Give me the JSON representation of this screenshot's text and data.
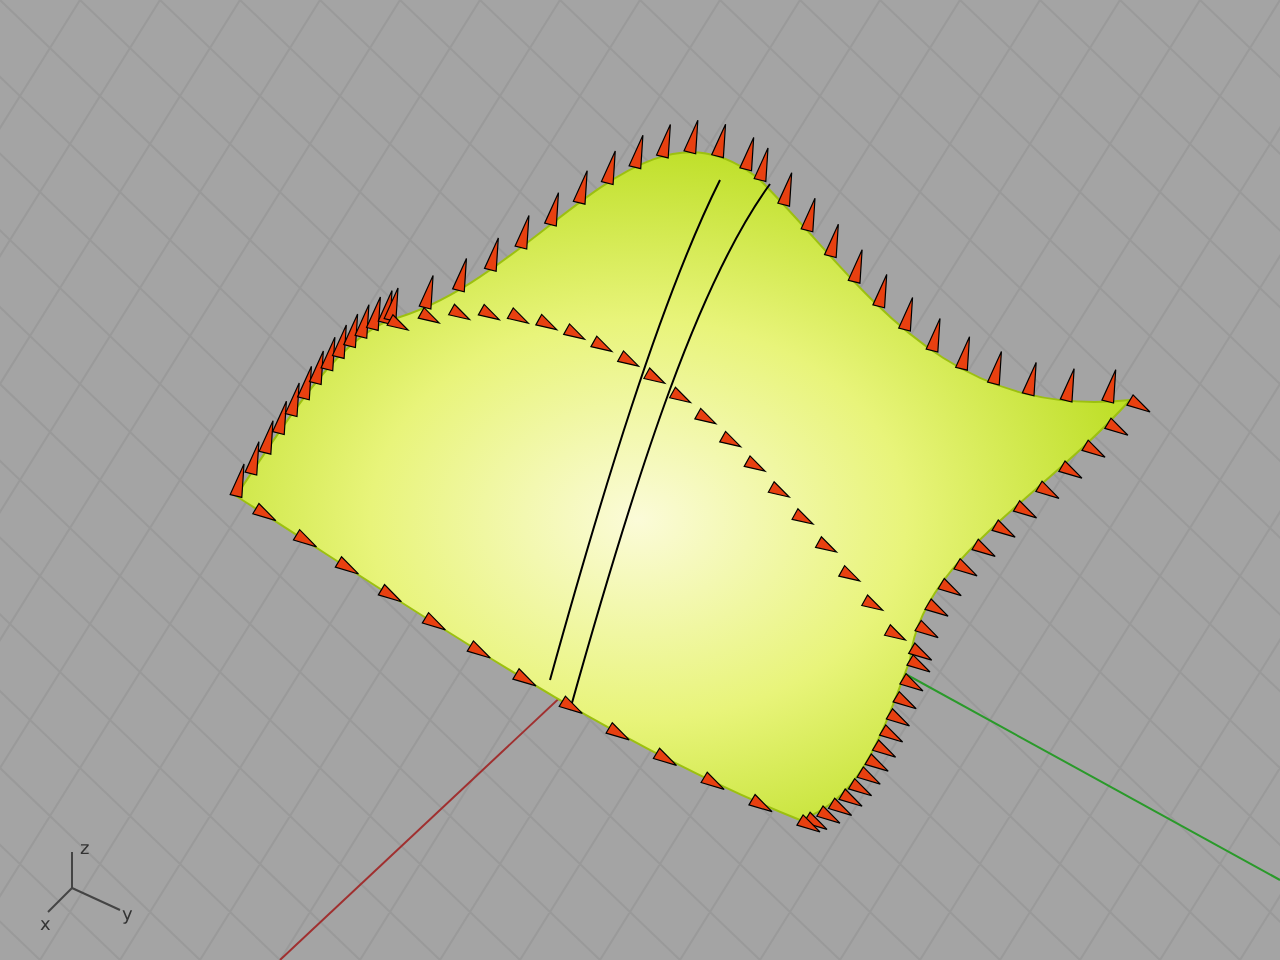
{
  "viewport": {
    "axis_labels": [
      "z",
      "x",
      "y"
    ]
  }
}
